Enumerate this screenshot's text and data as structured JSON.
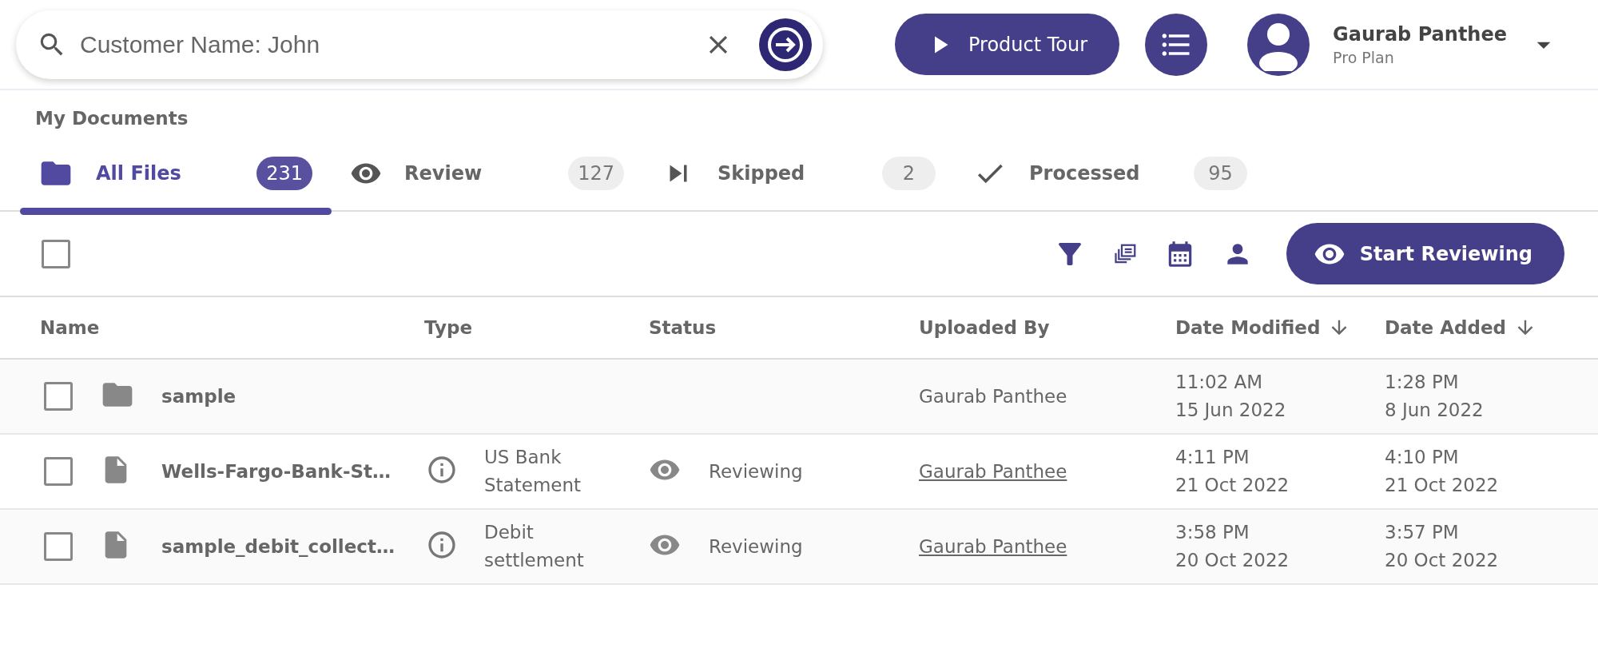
{
  "search": {
    "value": "Customer Name: John"
  },
  "header": {
    "tour_button": "Product Tour",
    "user": {
      "name": "Gaurab Panthee",
      "plan": "Pro Plan"
    }
  },
  "section_title": "My Documents",
  "tabs": [
    {
      "label": "All Files",
      "count": "231",
      "selected": true
    },
    {
      "label": "Review",
      "count": "127",
      "selected": false
    },
    {
      "label": "Skipped",
      "count": "2",
      "selected": false
    },
    {
      "label": "Processed",
      "count": "95",
      "selected": false
    }
  ],
  "toolbar": {
    "select_all_checked": false,
    "review_button": "Start Reviewing"
  },
  "table": {
    "columns": [
      {
        "label": "Name",
        "sorted": false
      },
      {
        "label": "Type",
        "sorted": false
      },
      {
        "label": "Status",
        "sorted": false
      },
      {
        "label": "Uploaded By",
        "sorted": false
      },
      {
        "label": "Date Modified",
        "sorted": true
      },
      {
        "label": "Date Added",
        "sorted": true
      }
    ],
    "rows": [
      {
        "kind": "folder",
        "checked": false,
        "name": "sample",
        "uploaded_by": "Gaurab Panthee",
        "uploader_link": false,
        "modified": [
          "11:02 AM",
          "15 Jun 2022"
        ],
        "added": [
          "1:28 PM",
          "8 Jun 2022"
        ]
      },
      {
        "kind": "file",
        "checked": false,
        "name": "Wells-Fargo-Bank-St…",
        "type": "US Bank Statement",
        "status": "Reviewing",
        "uploaded_by": "Gaurab Panthee",
        "uploader_link": true,
        "modified": [
          "4:11 PM",
          "21 Oct 2022"
        ],
        "added": [
          "4:10 PM",
          "21 Oct 2022"
        ]
      },
      {
        "kind": "file",
        "checked": false,
        "name": "sample_debit_collect…",
        "type": "Debit settlement",
        "status": "Reviewing",
        "uploaded_by": "Gaurab Panthee",
        "uploader_link": true,
        "modified": [
          "3:58 PM",
          "20 Oct 2022"
        ],
        "added": [
          "3:57 PM",
          "20 Oct 2022"
        ]
      }
    ]
  }
}
